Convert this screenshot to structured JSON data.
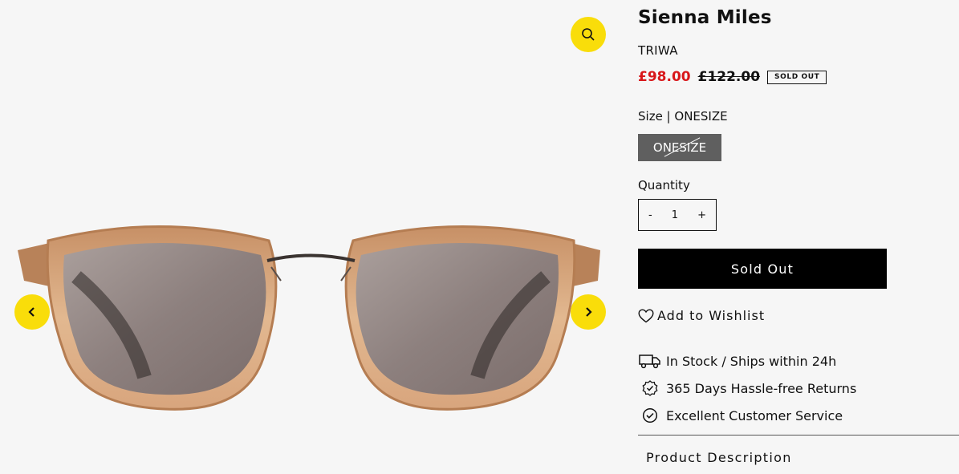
{
  "product": {
    "title": "Sienna Miles",
    "brand": "TRIWA",
    "sale_price": "£98.00",
    "original_price": "£122.00",
    "status_badge": "SOLD OUT"
  },
  "size": {
    "label": "Size | ONESIZE",
    "options": [
      "ONESIZE"
    ]
  },
  "quantity": {
    "label": "Quantity",
    "minus": "-",
    "value": "1",
    "plus": "+"
  },
  "buttons": {
    "sold_out": "Sold Out",
    "wishlist": "Add to Wishlist"
  },
  "features": [
    {
      "icon": "truck-icon",
      "text": "In Stock / Ships within 24h"
    },
    {
      "icon": "badge-check-icon",
      "text": "365 Days Hassle-free Returns"
    },
    {
      "icon": "circle-check-icon",
      "text": "Excellent Customer Service"
    }
  ],
  "accordion": {
    "product_description": "Product Description"
  },
  "gallery": {
    "icons": [
      "magnifier-icon",
      "chevron-left-icon",
      "chevron-right-icon"
    ]
  },
  "colors": {
    "accent": "#f9dd0a",
    "sale": "#d8171a",
    "button": "#000000",
    "size_selected": "#5f5f5f"
  }
}
